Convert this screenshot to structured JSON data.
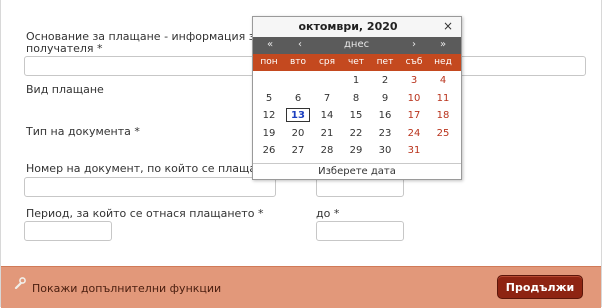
{
  "form": {
    "basis_label": "Основание за плащане - информация з",
    "basis_label_line2": "получателя *",
    "payment_kind_label": "Вид плащане",
    "doc_type_label": "Тип на документа *",
    "doc_number_label": "Номер на документ, по който се плаща",
    "period_label": "Период, за който се отнася плащането *",
    "period_to_label": "до *"
  },
  "calendar": {
    "title": "октомври, 2020",
    "close": "×",
    "nav": {
      "prev_year": "«",
      "prev_month": "‹",
      "today": "днес",
      "next_month": "›",
      "next_year": "»"
    },
    "weekdays": [
      "пон",
      "вто",
      "сря",
      "чет",
      "пет",
      "съб",
      "нед"
    ],
    "weeks": [
      [
        "",
        "",
        "",
        "1",
        "2",
        "3",
        "4"
      ],
      [
        "5",
        "6",
        "7",
        "8",
        "9",
        "10",
        "11"
      ],
      [
        "12",
        "13",
        "14",
        "15",
        "16",
        "17",
        "18"
      ],
      [
        "19",
        "20",
        "21",
        "22",
        "23",
        "24",
        "25"
      ],
      [
        "26",
        "27",
        "28",
        "29",
        "30",
        "31",
        ""
      ]
    ],
    "selected_day": "13",
    "footer": "Изберете дата",
    "weekend_color": "#b9331c",
    "header_color": "#c4491f"
  },
  "footer": {
    "more_functions": "Покажи допълнителни функции",
    "continue_button": "Продължи",
    "accent_color": "#e2987a",
    "button_color": "#8e2412"
  }
}
